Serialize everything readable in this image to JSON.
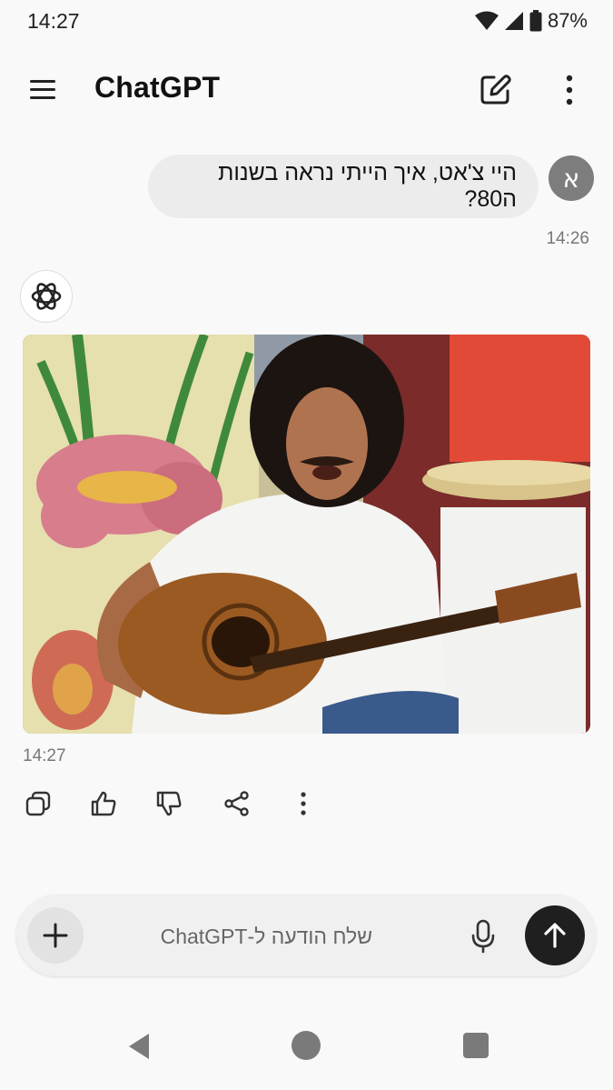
{
  "status_bar": {
    "time": "14:27",
    "battery": "87%",
    "icons": [
      "wifi-icon",
      "cellular-signal-icon",
      "battery-icon"
    ]
  },
  "header": {
    "title": "ChatGPT",
    "icons": [
      "menu-icon",
      "new-chat-icon",
      "more-vertical-icon"
    ]
  },
  "conversation": {
    "user_message": {
      "avatar_letter": "א",
      "text": "היי צ'אט, איך הייתי נראה בשנות ה80?",
      "time": "14:26"
    },
    "assistant_message": {
      "logo": "openai-logo-icon",
      "image": "generated-image-man-with-curly-hair-playing-guitar",
      "time": "14:27",
      "actions": [
        "copy-icon",
        "thumbs-up-icon",
        "thumbs-down-icon",
        "share-icon",
        "more-vertical-icon"
      ]
    }
  },
  "composer": {
    "placeholder": "שלח הודעה ל-ChatGPT",
    "icons": [
      "plus-icon",
      "microphone-icon",
      "send-arrow-icon"
    ]
  },
  "navigation_bar": {
    "icons": [
      "back-icon",
      "home-icon",
      "recents-icon"
    ]
  },
  "colors": {
    "background": "#f9f9f9",
    "user_bubble": "#ececec",
    "avatar": "#7d7d7d",
    "send_button": "#1f1f1f"
  }
}
